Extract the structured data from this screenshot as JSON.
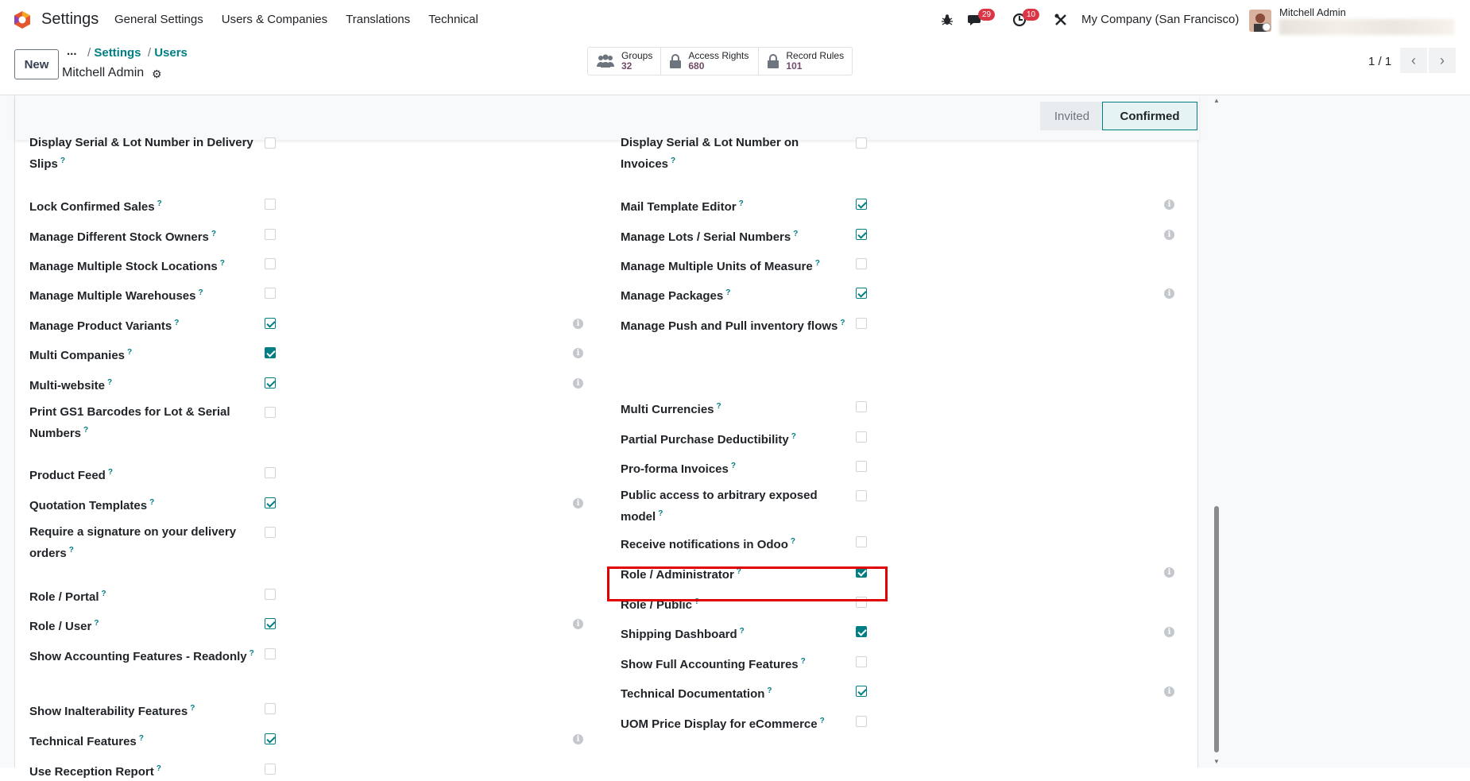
{
  "nav": {
    "app_name": "Settings",
    "menu": [
      "General Settings",
      "Users & Companies",
      "Translations",
      "Technical"
    ],
    "messages_count": "29",
    "activities_count": "10",
    "company": "My Company (San Francisco)",
    "user_name": "Mitchell Admin"
  },
  "control_panel": {
    "new_label": "New",
    "dots": "...",
    "breadcrumb": [
      "Settings",
      "Users"
    ],
    "record_name": "Mitchell Admin",
    "smart_buttons": [
      {
        "label": "Groups",
        "count": "32",
        "icon": "users-icon"
      },
      {
        "label": "Access Rights",
        "count": "680",
        "icon": "lock-icon"
      },
      {
        "label": "Record Rules",
        "count": "101",
        "icon": "lock-icon"
      }
    ],
    "pager": "1 / 1"
  },
  "status": {
    "invited": "Invited",
    "confirmed": "Confirmed"
  },
  "left_column": [
    {
      "label": "Display Serial & Lot Number in Delivery Slips",
      "checked": false
    },
    {
      "label": "Lock Confirmed Sales",
      "checked": false
    },
    {
      "label": "Manage Different Stock Owners",
      "checked": false
    },
    {
      "label": "Manage Multiple Stock Locations",
      "checked": false
    },
    {
      "label": "Manage Multiple Warehouses",
      "checked": false
    },
    {
      "label": "Manage Product Variants",
      "checked": true
    },
    {
      "label": "Multi Companies",
      "checked": true
    },
    {
      "label": "Multi-website",
      "checked": true
    },
    {
      "label": "Print GS1 Barcodes for Lot & Serial Numbers",
      "checked": false
    },
    {
      "label": "Product Feed",
      "checked": false
    },
    {
      "label": "Quotation Templates",
      "checked": true
    },
    {
      "label": "Require a signature on your delivery orders",
      "checked": false
    },
    {
      "label": "Role / Portal",
      "checked": false
    },
    {
      "label": "Role / User",
      "checked": true
    },
    {
      "label": "Show Accounting Features - Readonly",
      "checked": false
    },
    {
      "label": "Show Inalterability Features",
      "checked": false
    },
    {
      "label": "Technical Features",
      "checked": true
    },
    {
      "label": "Use Reception Report",
      "checked": false
    }
  ],
  "right_column": [
    {
      "label": "Display Serial & Lot Number on Invoices",
      "checked": false
    },
    {
      "label": "Mail Template Editor",
      "checked": true
    },
    {
      "label": "Manage Lots / Serial Numbers",
      "checked": true
    },
    {
      "label": "Manage Multiple Units of Measure",
      "checked": false
    },
    {
      "label": "Manage Packages",
      "checked": true
    },
    {
      "label": "Manage Push and Pull inventory flows",
      "checked": false
    },
    {
      "label": "Multi Currencies",
      "checked": false
    },
    {
      "label": "Partial Purchase Deductibility",
      "checked": false
    },
    {
      "label": "Pro-forma Invoices",
      "checked": false
    },
    {
      "label": "Public access to arbitrary exposed model",
      "checked": false
    },
    {
      "label": "Receive notifications in Odoo",
      "checked": false
    },
    {
      "label": "Role / Administrator",
      "checked": true
    },
    {
      "label": "Role / Public",
      "checked": false
    },
    {
      "label": "Shipping Dashboard",
      "checked": true
    },
    {
      "label": "Show Full Accounting Features",
      "checked": false
    },
    {
      "label": "Technical Documentation",
      "checked": true
    },
    {
      "label": "UOM Price Display for eCommerce",
      "checked": false
    }
  ]
}
